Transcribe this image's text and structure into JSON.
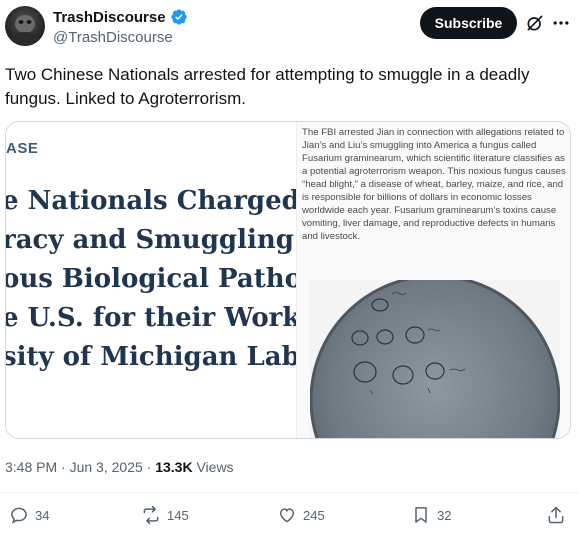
{
  "author": {
    "display_name": "TrashDiscourse",
    "handle": "@TrashDiscourse",
    "verified": true,
    "verified_color": "#1d9bf0"
  },
  "header": {
    "subscribe_label": "Subscribe",
    "grok_icon": "grok-icon",
    "more_icon": "more-icon"
  },
  "tweet": {
    "text": "Two Chinese Nationals arrested for attempting to smuggle in a deadly fungus. Linked to Agroterrorism."
  },
  "media": {
    "left": {
      "tag": "ASE",
      "headline_lines": [
        "e Nationals Charged v",
        "racy and Smuggling a",
        "ous Biological Pathoç",
        "e U.S. for their Work a",
        "sity of Michigan Labo"
      ]
    },
    "right": {
      "article_text": "The FBI arrested Jian in connection with allegations related to Jian’s and Liu’s smuggling into America a fungus called Fusarium graminearum, which scientific literature classifies as a potential agroterrorism weapon. This noxious fungus causes “head blight,” a disease of wheat, barley, maize, and rice, and is responsible for billions of dollars in economic losses worldwide each year. Fusarium graminearum’s toxins cause vomiting, liver damage, and reproductive defects in humans and livestock."
    }
  },
  "meta": {
    "time": "3:48 PM",
    "date": "Jun 3, 2025",
    "separator": "·",
    "views_count": "13.3K",
    "views_label": "Views"
  },
  "actions": {
    "replies": "34",
    "reposts": "145",
    "likes": "245",
    "bookmarks": "32"
  },
  "colors": {
    "text_primary": "#0f1419",
    "text_secondary": "#536471",
    "headline_blue": "#1f3550",
    "border": "#cfd9de"
  }
}
